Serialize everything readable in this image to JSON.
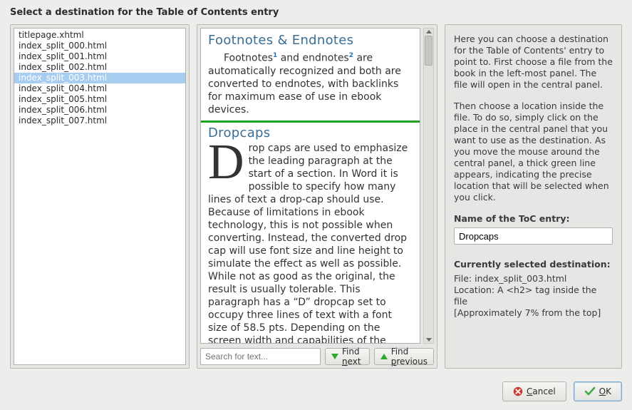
{
  "title": "Select a destination for the Table of Contents entry",
  "files": [
    {
      "name": "titlepage.xhtml",
      "selected": false
    },
    {
      "name": "index_split_000.html",
      "selected": false
    },
    {
      "name": "index_split_001.html",
      "selected": false
    },
    {
      "name": "index_split_002.html",
      "selected": false
    },
    {
      "name": "index_split_003.html",
      "selected": true
    },
    {
      "name": "index_split_004.html",
      "selected": false
    },
    {
      "name": "index_split_005.html",
      "selected": false
    },
    {
      "name": "index_split_006.html",
      "selected": false
    },
    {
      "name": "index_split_007.html",
      "selected": false
    }
  ],
  "preview": {
    "heading1": "Footnotes & Endnotes",
    "para1_a": "Footnotes",
    "para1_sup1": "1",
    "para1_b": " and endnotes",
    "para1_sup2": "2",
    "para1_c": " are automatically recognized and both are converted to endnotes, with backlinks for maximum ease of use in ebook devices.",
    "heading2": "Dropcaps",
    "para2_drop": "D",
    "para2": "rop caps are used to emphasize the leading paragraph at the start of a section. In Word it is possible to specify how many lines of text a drop-cap should use. Because of limitations in ebook technology, this is not possible when converting. Instead, the converted drop cap will use font size and line height to simulate the effect as well as possible. While not as good as the original, the result is usually tolerable. This paragraph has a “D” dropcap set to occupy three lines of text with a font size of 58.5 pts. Depending on the screen width and capabilities of the device you view the"
  },
  "search": {
    "placeholder": "Search for text...",
    "find_next": "Find next",
    "find_prev": "Find previous",
    "find_next_ul": "n",
    "find_prev_ul": "p"
  },
  "help": {
    "p1": "Here you can choose a destination for the Table of Contents' entry to point to. First choose a file from the book in the left-most panel. The file will open in the central panel.",
    "p2": "Then choose a location inside the file. To do so, simply click on the place in the central panel that you want to use as the destination. As you move the mouse around the central panel, a thick green line appears, indicating the precise location that will be selected when you click.",
    "name_label": "Name of the ToC entry:",
    "name_value": "Dropcaps",
    "dest_label": "Currently selected destination:",
    "dest_file": "File: index_split_003.html",
    "dest_loc": "Location: A <h2> tag inside the file",
    "dest_approx": "[Approximately 7% from the top]"
  },
  "buttons": {
    "cancel": "Cancel",
    "ok": "OK",
    "cancel_ul": "C",
    "ok_ul": "O"
  }
}
